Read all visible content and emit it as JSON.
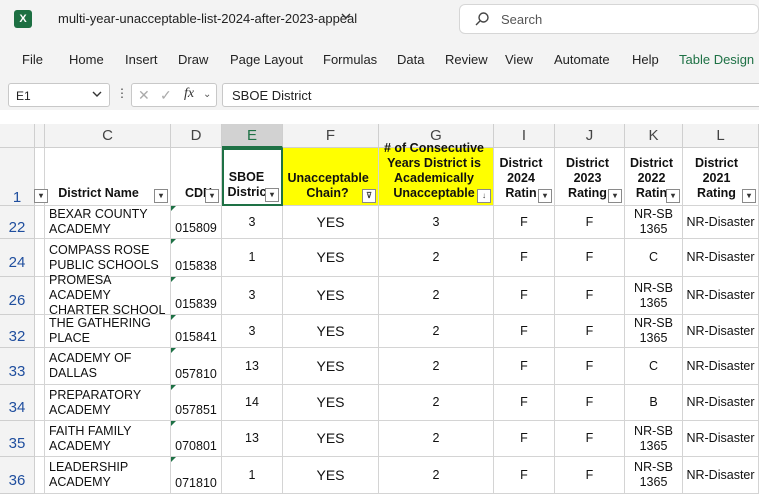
{
  "title_bar": {
    "file_name": "multi-year-unacceptable-list-2024-after-2023-appeal",
    "search_placeholder": "Search",
    "app_icon_label": "X"
  },
  "menu": {
    "items": [
      "File",
      "Home",
      "Insert",
      "Draw",
      "Page Layout",
      "Formulas",
      "Data",
      "Review",
      "View",
      "Automate",
      "Help",
      "Table Design"
    ]
  },
  "formula_bar": {
    "cell_ref": "E1",
    "fx_label": "fx",
    "value": "SBOE District"
  },
  "columns": [
    "C",
    "D",
    "E",
    "F",
    "G",
    "I",
    "J",
    "K",
    "L"
  ],
  "header_row": {
    "row_number": "1",
    "cells": [
      "District Name",
      "CDN",
      "SBOE Distric",
      "Unacceptable Chain?",
      "# of Consecutive Years District is Academically Unacceptable",
      "District 2024 Ratin",
      "District 2023 Rating",
      "District 2022 Ratin",
      "District 2021 Rating"
    ]
  },
  "rows": [
    {
      "row": "22",
      "cells": [
        "BEXAR COUNTY ACADEMY",
        "015809",
        "3",
        "YES",
        "3",
        "F",
        "F",
        "NR-SB 1365",
        "NR-Disaster"
      ]
    },
    {
      "row": "24",
      "cells": [
        "COMPASS ROSE PUBLIC SCHOOLS",
        "015838",
        "1",
        "YES",
        "2",
        "F",
        "F",
        "C",
        "NR-Disaster"
      ]
    },
    {
      "row": "26",
      "cells": [
        "PROMESA ACADEMY CHARTER SCHOOL",
        "015839",
        "3",
        "YES",
        "2",
        "F",
        "F",
        "NR-SB 1365",
        "NR-Disaster"
      ]
    },
    {
      "row": "32",
      "cells": [
        "THE GATHERING PLACE",
        "015841",
        "3",
        "YES",
        "2",
        "F",
        "F",
        "NR-SB 1365",
        "NR-Disaster"
      ]
    },
    {
      "row": "33",
      "cells": [
        "ACADEMY OF DALLAS",
        "057810",
        "13",
        "YES",
        "2",
        "F",
        "F",
        "C",
        "NR-Disaster"
      ]
    },
    {
      "row": "34",
      "cells": [
        "PREPARATORY ACADEMY",
        "057851",
        "14",
        "YES",
        "2",
        "F",
        "F",
        "B",
        "NR-Disaster"
      ]
    },
    {
      "row": "35",
      "cells": [
        "FAITH FAMILY ACADEMY",
        "070801",
        "13",
        "YES",
        "2",
        "F",
        "F",
        "NR-SB 1365",
        "NR-Disaster"
      ]
    },
    {
      "row": "36",
      "cells": [
        "LEADERSHIP ACADEMY",
        "071810",
        "1",
        "YES",
        "2",
        "F",
        "F",
        "NR-SB 1365",
        "NR-Disaster"
      ]
    }
  ],
  "colors": {
    "accent": "#1e7145",
    "highlight": "#ffff00",
    "row_number": "#1f4e9e"
  }
}
